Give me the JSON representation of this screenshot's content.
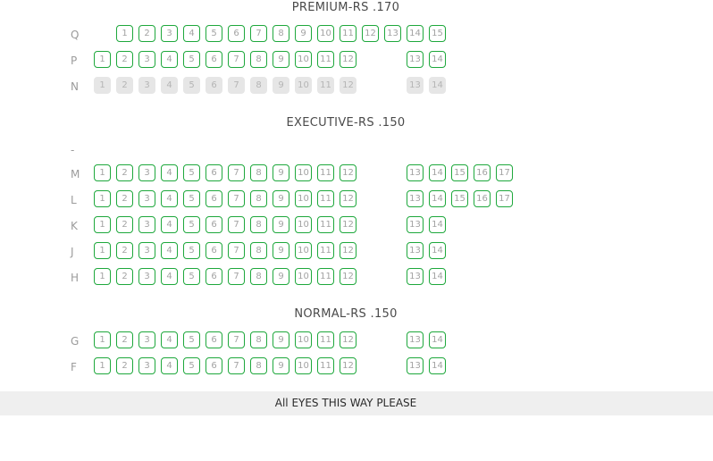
{
  "sections": [
    {
      "title": "PREMIUM-RS .170",
      "rows": [
        {
          "label": "Q",
          "seats": [
            {
              "n": "1",
              "sold": false
            },
            {
              "n": "2",
              "sold": false
            },
            {
              "n": "3",
              "sold": false
            },
            {
              "n": "4",
              "sold": false
            },
            {
              "n": "5",
              "sold": false
            },
            {
              "n": "6",
              "sold": false
            },
            {
              "n": "7",
              "sold": false
            },
            {
              "n": "8",
              "sold": false
            },
            {
              "n": "9",
              "sold": false
            },
            {
              "n": "10",
              "sold": false
            },
            {
              "n": "11",
              "sold": false
            },
            {
              "n": "12",
              "sold": false
            },
            {
              "n": "13",
              "sold": false
            },
            {
              "n": "14",
              "sold": false
            },
            {
              "n": "15",
              "sold": false
            }
          ]
        },
        {
          "label": "P",
          "seats": [
            {
              "n": "1",
              "sold": false
            },
            {
              "n": "2",
              "sold": false
            },
            {
              "n": "3",
              "sold": false
            },
            {
              "n": "4",
              "sold": false
            },
            {
              "n": "5",
              "sold": false
            },
            {
              "n": "6",
              "sold": false
            },
            {
              "n": "7",
              "sold": false
            },
            {
              "n": "8",
              "sold": false
            },
            {
              "n": "9",
              "sold": false
            },
            {
              "n": "10",
              "sold": false
            },
            {
              "n": "11",
              "sold": false
            },
            {
              "n": "12",
              "sold": false
            },
            {
              "n": "13",
              "sold": false
            },
            {
              "n": "14",
              "sold": false
            }
          ]
        },
        {
          "label": "N",
          "seats": [
            {
              "n": "1",
              "sold": true
            },
            {
              "n": "2",
              "sold": true
            },
            {
              "n": "3",
              "sold": true
            },
            {
              "n": "4",
              "sold": true
            },
            {
              "n": "5",
              "sold": true
            },
            {
              "n": "6",
              "sold": true
            },
            {
              "n": "7",
              "sold": true
            },
            {
              "n": "8",
              "sold": true
            },
            {
              "n": "9",
              "sold": true
            },
            {
              "n": "10",
              "sold": true
            },
            {
              "n": "11",
              "sold": true
            },
            {
              "n": "12",
              "sold": true
            },
            {
              "n": "13",
              "sold": true
            },
            {
              "n": "14",
              "sold": true
            }
          ]
        }
      ]
    },
    {
      "title": "EXECUTIVE-RS .150",
      "rows": [
        {
          "label": "-",
          "seats": []
        },
        {
          "label": "M",
          "seats": [
            {
              "n": "1",
              "sold": false
            },
            {
              "n": "2",
              "sold": false
            },
            {
              "n": "3",
              "sold": false
            },
            {
              "n": "4",
              "sold": false
            },
            {
              "n": "5",
              "sold": false
            },
            {
              "n": "6",
              "sold": false
            },
            {
              "n": "7",
              "sold": false
            },
            {
              "n": "8",
              "sold": false
            },
            {
              "n": "9",
              "sold": false
            },
            {
              "n": "10",
              "sold": false
            },
            {
              "n": "11",
              "sold": false
            },
            {
              "n": "12",
              "sold": false
            },
            {
              "n": "13",
              "sold": false
            },
            {
              "n": "14",
              "sold": false
            },
            {
              "n": "15",
              "sold": false
            },
            {
              "n": "16",
              "sold": false
            },
            {
              "n": "17",
              "sold": false
            }
          ]
        },
        {
          "label": "L",
          "seats": [
            {
              "n": "1",
              "sold": false
            },
            {
              "n": "2",
              "sold": false
            },
            {
              "n": "3",
              "sold": false
            },
            {
              "n": "4",
              "sold": false
            },
            {
              "n": "5",
              "sold": false
            },
            {
              "n": "6",
              "sold": false
            },
            {
              "n": "7",
              "sold": false
            },
            {
              "n": "8",
              "sold": false
            },
            {
              "n": "9",
              "sold": false
            },
            {
              "n": "10",
              "sold": false
            },
            {
              "n": "11",
              "sold": false
            },
            {
              "n": "12",
              "sold": false
            },
            {
              "n": "13",
              "sold": false
            },
            {
              "n": "14",
              "sold": false
            },
            {
              "n": "15",
              "sold": false
            },
            {
              "n": "16",
              "sold": false
            },
            {
              "n": "17",
              "sold": false
            }
          ]
        },
        {
          "label": "K",
          "seats": [
            {
              "n": "1",
              "sold": false
            },
            {
              "n": "2",
              "sold": false
            },
            {
              "n": "3",
              "sold": false
            },
            {
              "n": "4",
              "sold": false
            },
            {
              "n": "5",
              "sold": false
            },
            {
              "n": "6",
              "sold": false
            },
            {
              "n": "7",
              "sold": false
            },
            {
              "n": "8",
              "sold": false
            },
            {
              "n": "9",
              "sold": false
            },
            {
              "n": "10",
              "sold": false
            },
            {
              "n": "11",
              "sold": false
            },
            {
              "n": "12",
              "sold": false
            },
            {
              "n": "13",
              "sold": false
            },
            {
              "n": "14",
              "sold": false
            }
          ]
        },
        {
          "label": "J",
          "seats": [
            {
              "n": "1",
              "sold": false
            },
            {
              "n": "2",
              "sold": false
            },
            {
              "n": "3",
              "sold": false
            },
            {
              "n": "4",
              "sold": false
            },
            {
              "n": "5",
              "sold": false
            },
            {
              "n": "6",
              "sold": false
            },
            {
              "n": "7",
              "sold": false
            },
            {
              "n": "8",
              "sold": false
            },
            {
              "n": "9",
              "sold": false
            },
            {
              "n": "10",
              "sold": false
            },
            {
              "n": "11",
              "sold": false
            },
            {
              "n": "12",
              "sold": false
            },
            {
              "n": "13",
              "sold": false
            },
            {
              "n": "14",
              "sold": false
            }
          ]
        },
        {
          "label": "H",
          "seats": [
            {
              "n": "1",
              "sold": false
            },
            {
              "n": "2",
              "sold": false
            },
            {
              "n": "3",
              "sold": false
            },
            {
              "n": "4",
              "sold": false
            },
            {
              "n": "5",
              "sold": false
            },
            {
              "n": "6",
              "sold": false
            },
            {
              "n": "7",
              "sold": false
            },
            {
              "n": "8",
              "sold": false
            },
            {
              "n": "9",
              "sold": false
            },
            {
              "n": "10",
              "sold": false
            },
            {
              "n": "11",
              "sold": false
            },
            {
              "n": "12",
              "sold": false
            },
            {
              "n": "13",
              "sold": false
            },
            {
              "n": "14",
              "sold": false
            }
          ]
        }
      ]
    },
    {
      "title": "NORMAL-RS .150",
      "rows": [
        {
          "label": "G",
          "seats": [
            {
              "n": "1",
              "sold": false
            },
            {
              "n": "2",
              "sold": false
            },
            {
              "n": "3",
              "sold": false
            },
            {
              "n": "4",
              "sold": false
            },
            {
              "n": "5",
              "sold": false
            },
            {
              "n": "6",
              "sold": false
            },
            {
              "n": "7",
              "sold": false
            },
            {
              "n": "8",
              "sold": false
            },
            {
              "n": "9",
              "sold": false
            },
            {
              "n": "10",
              "sold": false
            },
            {
              "n": "11",
              "sold": false
            },
            {
              "n": "12",
              "sold": false
            },
            {
              "n": "13",
              "sold": false
            },
            {
              "n": "14",
              "sold": false
            }
          ]
        },
        {
          "label": "F",
          "seats": [
            {
              "n": "1",
              "sold": false
            },
            {
              "n": "2",
              "sold": false
            },
            {
              "n": "3",
              "sold": false
            },
            {
              "n": "4",
              "sold": false
            },
            {
              "n": "5",
              "sold": false
            },
            {
              "n": "6",
              "sold": false
            },
            {
              "n": "7",
              "sold": false
            },
            {
              "n": "8",
              "sold": false
            },
            {
              "n": "9",
              "sold": false
            },
            {
              "n": "10",
              "sold": false
            },
            {
              "n": "11",
              "sold": false
            },
            {
              "n": "12",
              "sold": false
            },
            {
              "n": "13",
              "sold": false
            },
            {
              "n": "14",
              "sold": false
            }
          ]
        }
      ]
    }
  ],
  "screen": {
    "label": "All EYES THIS WAY PLEASE"
  },
  "colors": {
    "available_border": "#1ea83c",
    "sold_fill": "#e6e6e6",
    "screen_bar": "#efefef"
  }
}
